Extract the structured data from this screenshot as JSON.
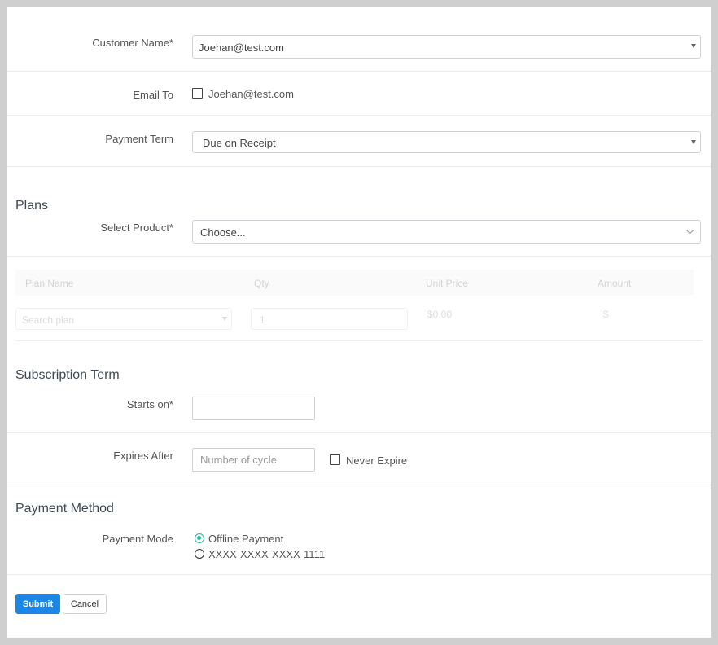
{
  "customer": {
    "label": "Customer Name*",
    "value": "Joehan@test.com"
  },
  "email_to": {
    "label": "Email To",
    "checkbox_label": "Joehan@test.com",
    "checked": false
  },
  "payment_term": {
    "label": "Payment Term",
    "value": "Due on Receipt"
  },
  "plans": {
    "heading": "Plans",
    "select_product_label": "Select Product*",
    "select_product_value": "Choose...",
    "table": {
      "columns": [
        "Plan Name",
        "Qty",
        "Unit Price",
        "Amount"
      ],
      "row": {
        "plan_placeholder": "Search plan",
        "qty": "1",
        "unit_price": "$0.00",
        "amount": "$"
      }
    }
  },
  "subscription": {
    "heading": "Subscription Term",
    "starts_on_label": "Starts on*",
    "starts_on_value": "",
    "expires_label": "Expires After",
    "expires_placeholder": "Number of cycle",
    "never_expire_label": "Never Expire"
  },
  "payment_method": {
    "heading": "Payment Method",
    "mode_label": "Payment Mode",
    "options": [
      {
        "label": "Offline Payment",
        "selected": true
      },
      {
        "label": "XXXX-XXXX-XXXX-1111",
        "selected": false
      }
    ]
  },
  "actions": {
    "submit": "Submit",
    "cancel": "Cancel"
  },
  "colors": {
    "primary": "#1a87e6",
    "radio_accent": "#2bb39a"
  }
}
